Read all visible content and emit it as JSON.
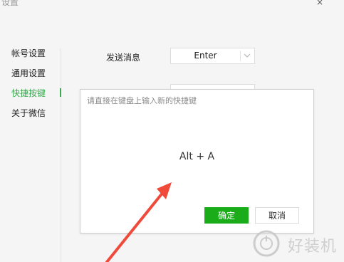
{
  "window": {
    "title": "设置",
    "close_glyph": "×"
  },
  "sidebar": {
    "items": [
      {
        "label": "帐号设置"
      },
      {
        "label": "通用设置"
      },
      {
        "label": "快捷按键",
        "active": true
      },
      {
        "label": "关于微信"
      }
    ]
  },
  "settings": {
    "send_message": {
      "label": "发送消息",
      "value": "Enter"
    }
  },
  "dialog": {
    "prompt": "请直接在键盘上输入新的快捷键",
    "shortcut": "Alt + A",
    "confirm_label": "确定",
    "cancel_label": "取消"
  },
  "watermark": {
    "text": "好装机"
  },
  "colors": {
    "accent_green": "#1aad19",
    "active_text": "#3aa84f",
    "annotation_arrow": "#f04a3a"
  },
  "icons": {
    "dropdown": "chevron-down-icon",
    "watermark_logo": "power-circle-icon",
    "annotation": "red-arrow"
  }
}
